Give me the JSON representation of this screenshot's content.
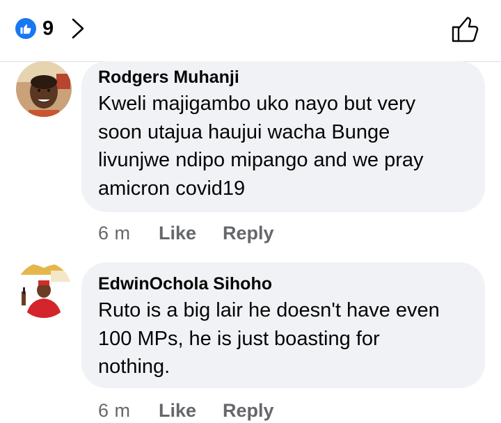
{
  "header": {
    "like_count": "9",
    "reaction_icon": "like-reaction-icon",
    "chevron_icon": "chevron-right-icon",
    "like_button_icon": "thumbs-up-outline-icon"
  },
  "comments": [
    {
      "author": "Rodgers Muhanji",
      "text": "Kweli majigambo uko nayo but very\nsoon utajua haujui wacha Bunge\nlivunjwe ndipo mipango and we pray\namicron covid19",
      "time": "6 m",
      "like_label": "Like",
      "reply_label": "Reply"
    },
    {
      "author": "EdwinOchola Sihoho",
      "text": "Ruto is a big lair he doesn't have even\n100 MPs, he is just boasting for\nnothing.",
      "time": "6 m",
      "like_label": "Like",
      "reply_label": "Reply"
    }
  ],
  "colors": {
    "accent": "#1877f2",
    "bubble": "#f0f2f5",
    "secondary_text": "#65676b",
    "primary_text": "#050505"
  }
}
